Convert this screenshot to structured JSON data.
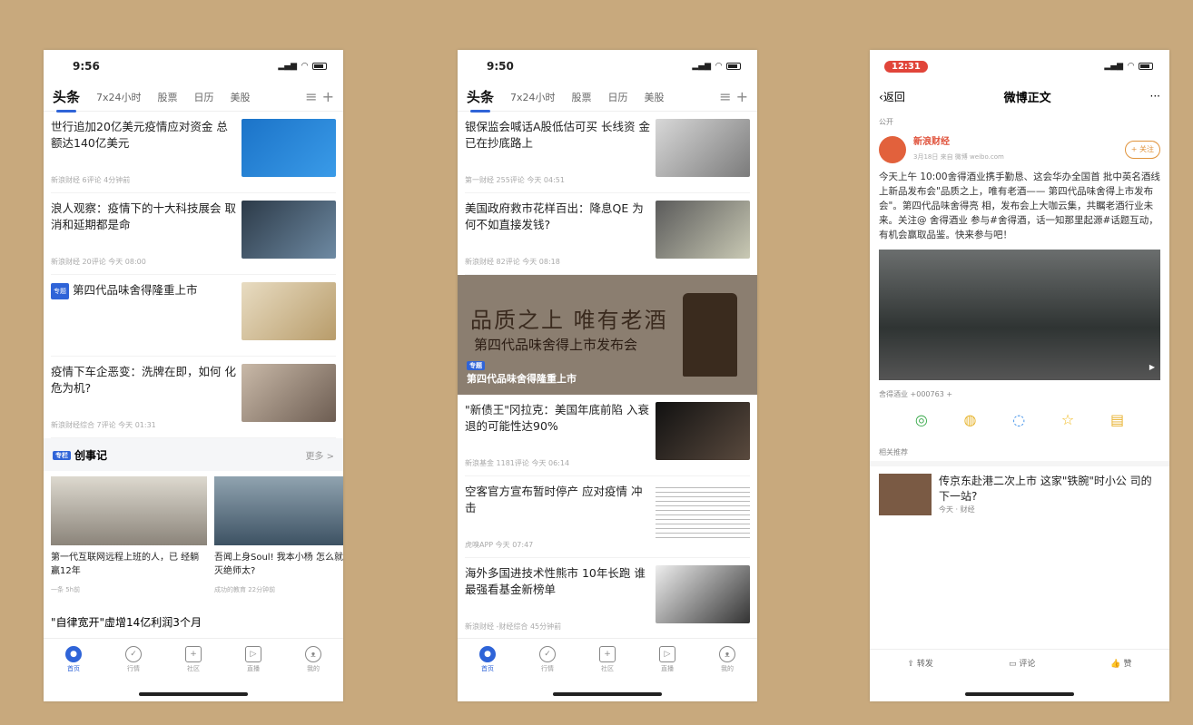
{
  "phone1": {
    "time": "9:56",
    "tabs": [
      "头条",
      "7x24小时",
      "股票",
      "日历",
      "美股"
    ],
    "articles": [
      {
        "title": "世行追加20亿美元疫情应对资金 总额达140亿美元",
        "meta": "新浪财经 6评论 4分钟前"
      },
      {
        "title": "浪人观察：疫情下的十大科技展会 取消和延期都是命",
        "meta": "新浪财经 20评论 今天 08:00"
      },
      {
        "title": "第四代品味舍得隆重上市",
        "meta": "",
        "tag": "专题"
      },
      {
        "title": "疫情下车企恶变：洗牌在即，如何 化危为机?",
        "meta": "新浪财经综合 7评论 今天 01:31"
      }
    ],
    "section": {
      "tag": "专栏",
      "title": "创事记",
      "more": "更多 >"
    },
    "cards": [
      {
        "title": "第一代互联网远程上班的人，已 经躺赢12年",
        "meta": "一条 5h前"
      },
      {
        "title": "吾闻上身Soul! 我本小杨 怎么就活成了灭绝师太?",
        "meta": "成功的教育 22分钟前"
      }
    ],
    "last": "\"自律宽开\"虚增14亿利润3个月",
    "nav": [
      "首页",
      "行情",
      "社区",
      "直播",
      "我的"
    ]
  },
  "phone2": {
    "time": "9:50",
    "tabs": [
      "头条",
      "7x24小时",
      "股票",
      "日历",
      "美股"
    ],
    "articles": [
      {
        "title": "银保监会喊话A股低估可买 长线资 金已在抄底路上",
        "meta": "第一财经 255评论 今天 04:51"
      },
      {
        "title": "美国政府救市花样百出：降息QE 为何不如直接发钱?",
        "meta": "新浪财经 82评论 今天 08:18"
      }
    ],
    "banner": {
      "title": "品质之上 唯有老酒",
      "subtitle": "第四代品味舍得上市发布会",
      "tag": "专题",
      "label": "第四代品味舍得隆重上市"
    },
    "articles2": [
      {
        "title": "\"新债王\"冈拉克：美国年底前陷 入衰退的可能性达90%",
        "meta": "新浪基金 1181评论 今天 06:14"
      },
      {
        "title": "空客官方宣布暂时停产 应对疫情 冲击",
        "meta": "虎嗅APP 今天 07:47"
      },
      {
        "title": "海外多国进技术性熊市 10年长跑 谁最强看基金新榜单",
        "meta": "新浪财经 -财经综合 45分钟前"
      }
    ],
    "nav": [
      "首页",
      "行情",
      "社区",
      "直播",
      "我的"
    ]
  },
  "phone3": {
    "time": "12:31",
    "back": "返回",
    "title": "微博正文",
    "more": "···",
    "public": "公开",
    "user": "新浪财经",
    "utime": "3月18日 来自 微博 weibo.com",
    "follow": "+ 关注",
    "text": "今天上午 10:00舍得酒业携手勤恳、这会华办全国首 批中英名酒线上新品发布会\"品质之上，唯有老酒—— 第四代品味舍得上市发布会\"。第四代品味舍得亮 相，发布会上大咖云集，共瞩老酒行业未来。关注@ 舍得酒业 参与#舍得酒，话一知那里起源#话题互动， 有机会赢取品鉴。快来参与吧！",
    "tag_line": "舍得酒业 +000763 +",
    "related_head": "相关推荐",
    "related": "传京东赴港二次上市 这家\"铁腕\"时小公 司的下一站?",
    "related_meta": "今天 · 财经",
    "bar": [
      "转发",
      "评论",
      "赞"
    ]
  }
}
